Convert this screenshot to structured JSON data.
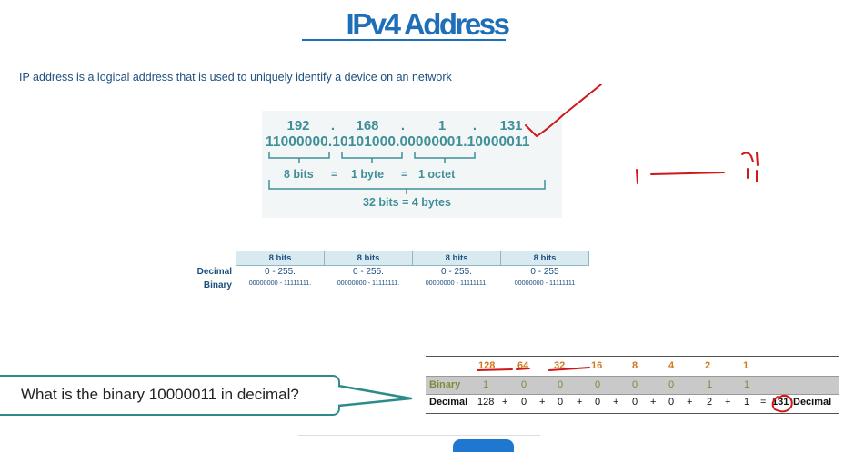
{
  "title": "IPv4 Address",
  "intro": "IP address is a logical address that is used to uniquely identify a device on an network",
  "ip_figure": {
    "octets": [
      "192",
      ".",
      "168",
      ".",
      "1",
      ".",
      "131"
    ],
    "binary": "11000000.10101000.00000001.10000011",
    "bits_label": "8 bits",
    "eq1": "=",
    "byte_label": "1 byte",
    "eq2": "=",
    "octet_label": "1 octet",
    "total_label": "32 bits = 4 bytes"
  },
  "bits_table": {
    "headers": [
      "8 bits",
      "8 bits",
      "8 bits",
      "8 bits"
    ],
    "row_labels": {
      "decimal": "Decimal",
      "binary": "Binary"
    },
    "decimal": [
      "0 - 255.",
      "0 - 255.",
      "0 - 255.",
      "0 - 255"
    ],
    "binary": [
      "00000000 - 11111111.",
      "00000000 - 11111111.",
      "00000000 - 11111111.",
      "00000000 - 11111111"
    ]
  },
  "question": "What is the binary 10000011 in decimal?",
  "conversion": {
    "powers": [
      "128",
      "64",
      "32",
      "16",
      "8",
      "4",
      "2",
      "1"
    ],
    "binary_label": "Binary",
    "binary": [
      "1",
      "0",
      "0",
      "0",
      "0",
      "0",
      "1",
      "1"
    ],
    "decimal_label": "Decimal",
    "decimal": [
      "128",
      "+",
      "0",
      "+",
      "0",
      "+",
      "0",
      "+",
      "0",
      "+",
      "0",
      "+",
      "2",
      "+",
      "1",
      "=",
      "131",
      "Decimal"
    ]
  },
  "colors": {
    "title": "#1f6fb8",
    "teal": "#3f8f99",
    "orange": "#d2781e",
    "ink": "#d01818",
    "callout_border": "#2e8b8b"
  }
}
